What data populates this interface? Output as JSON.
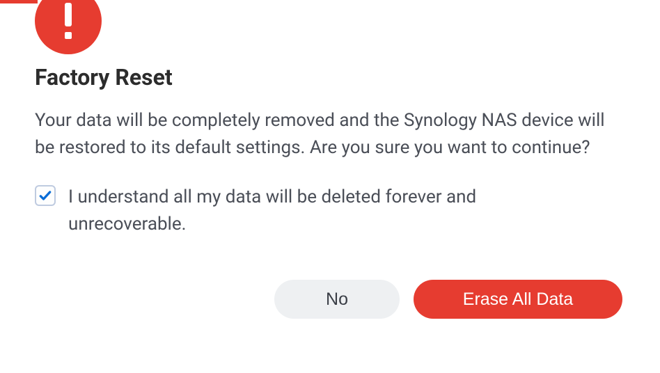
{
  "dialog": {
    "title": "Factory Reset",
    "body": "Your data will be completely removed and the Synology NAS device will be restored to its default settings. Are you sure you want to continue?",
    "checkbox": {
      "checked": true,
      "label": "I understand all my data will be deleted forever and unrecoverable."
    },
    "buttons": {
      "no": "No",
      "erase": "Erase All Data"
    }
  },
  "colors": {
    "danger": "#e63c30",
    "checkboxBorder": "#bfcbe0",
    "checkmark": "#0a6dd7"
  }
}
